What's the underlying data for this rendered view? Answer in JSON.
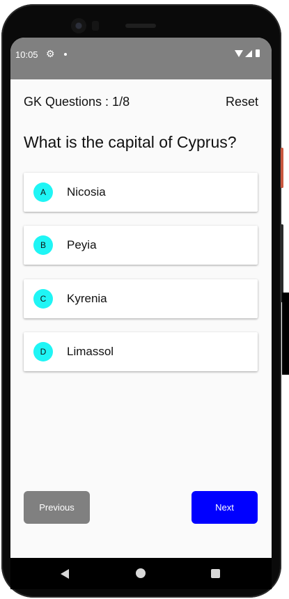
{
  "status_bar": {
    "time": "10:05",
    "settings_icon": "gear-icon",
    "wifi_icon": "wifi-icon",
    "signal_icon": "signal-icon",
    "battery_icon": "battery-icon",
    "background": "#808080"
  },
  "header": {
    "title": "GK Questions : 1/8",
    "reset_label": "Reset"
  },
  "question": {
    "text": "What is the capital of Cyprus?"
  },
  "options": [
    {
      "letter": "A",
      "label": "Nicosia"
    },
    {
      "letter": "B",
      "label": "Peyia"
    },
    {
      "letter": "C",
      "label": "Kyrenia"
    },
    {
      "letter": "D",
      "label": "Limassol"
    }
  ],
  "navigation": {
    "previous_label": "Previous",
    "next_label": "Next"
  },
  "colors": {
    "badge": "#1ff5f5",
    "previous_button": "#808080",
    "next_button": "#0000ff",
    "screen_background": "#fafafa"
  },
  "system_nav": {
    "back_icon": "back-triangle-icon",
    "home_icon": "home-circle-icon",
    "recents_icon": "recents-square-icon"
  }
}
